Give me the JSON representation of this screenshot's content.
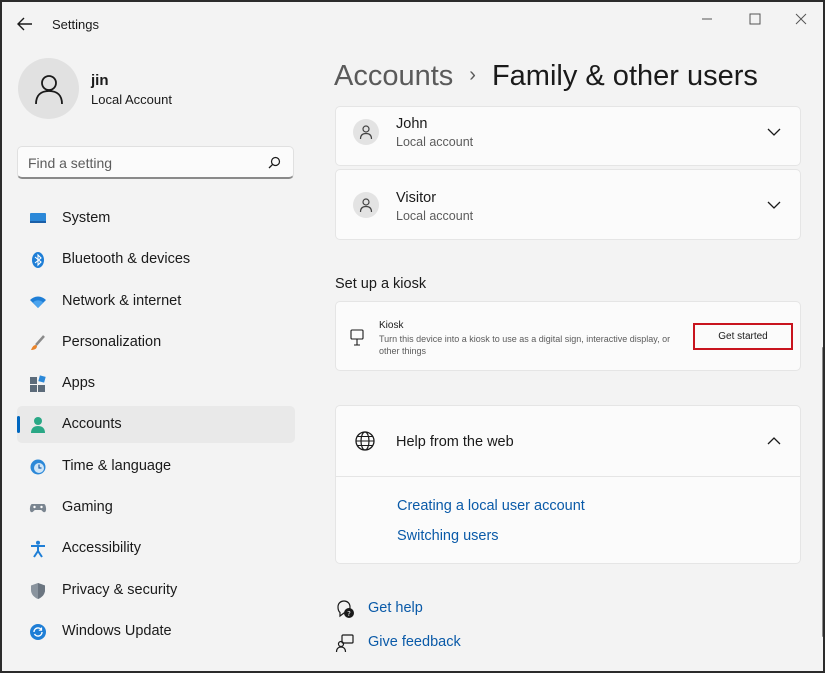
{
  "window": {
    "app_title": "Settings"
  },
  "profile": {
    "name": "jin",
    "account_type": "Local Account"
  },
  "search": {
    "placeholder": "Find a setting"
  },
  "nav": {
    "items": [
      {
        "label": "System",
        "icon": "system-icon"
      },
      {
        "label": "Bluetooth & devices",
        "icon": "bluetooth-icon"
      },
      {
        "label": "Network & internet",
        "icon": "wifi-icon"
      },
      {
        "label": "Personalization",
        "icon": "brush-icon"
      },
      {
        "label": "Apps",
        "icon": "apps-icon"
      },
      {
        "label": "Accounts",
        "icon": "person-icon",
        "active": true
      },
      {
        "label": "Time & language",
        "icon": "clock-icon"
      },
      {
        "label": "Gaming",
        "icon": "gamepad-icon"
      },
      {
        "label": "Accessibility",
        "icon": "accessibility-icon"
      },
      {
        "label": "Privacy & security",
        "icon": "shield-icon"
      },
      {
        "label": "Windows Update",
        "icon": "update-icon"
      }
    ]
  },
  "breadcrumb": {
    "parent": "Accounts",
    "separator": "›",
    "current": "Family & other users"
  },
  "users": [
    {
      "name": "John",
      "type": "Local account"
    },
    {
      "name": "Visitor",
      "type": "Local account"
    }
  ],
  "kiosk": {
    "section_title": "Set up a kiosk",
    "title": "Kiosk",
    "description": "Turn this device into a kiosk to use as a digital sign, interactive display, or other things",
    "button": "Get started"
  },
  "help": {
    "title": "Help from the web",
    "links": [
      "Creating a local user account",
      "Switching users"
    ]
  },
  "footer": {
    "get_help": "Get help",
    "give_feedback": "Give feedback"
  },
  "colors": {
    "accent": "#0067c0",
    "link": "#0a5aa8",
    "highlight_border": "#c8141e",
    "background": "#f3f3f3"
  }
}
